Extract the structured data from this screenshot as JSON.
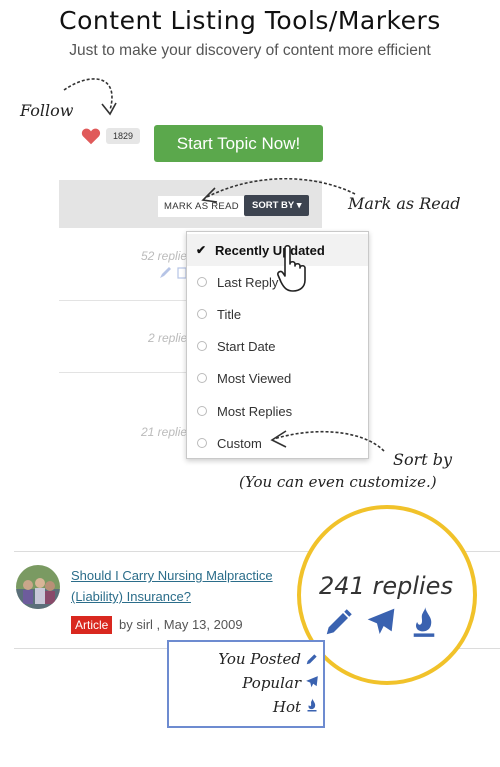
{
  "header": {
    "title": "Content Listing Tools/Markers",
    "subtitle": "Just to make your discovery of content more efficient"
  },
  "follow": {
    "label": "Follow",
    "count": "1829"
  },
  "start_topic": {
    "label": "Start Topic Now!"
  },
  "toolbar": {
    "mark_as_read": "MARK AS READ",
    "sort_by": "SORT BY ▾",
    "mark_annotation": "Mark as Read"
  },
  "ghost_rows": [
    {
      "text": "52 replie"
    },
    {
      "text": "2 replie"
    },
    {
      "text": "21 replie"
    }
  ],
  "sort_menu": {
    "items": [
      {
        "label": "Recently Updated",
        "selected": true
      },
      {
        "label": "Last Reply",
        "selected": false
      },
      {
        "label": "Title",
        "selected": false
      },
      {
        "label": "Start Date",
        "selected": false
      },
      {
        "label": "Most Viewed",
        "selected": false
      },
      {
        "label": "Most Replies",
        "selected": false
      },
      {
        "label": "Custom",
        "selected": false
      }
    ],
    "annotation": "Sort by",
    "annotation_note": "(You can even customize.)"
  },
  "topic": {
    "title_line1": "Should I Carry Nursing Malpractice",
    "title_line2": "(Liability) Insurance?",
    "tag": "Article",
    "byline": "by sirl , May 13, 2009"
  },
  "callout": {
    "replies": "241 replies",
    "icons": [
      "pencil-icon",
      "paper-plane-icon",
      "flame-icon"
    ],
    "accent": "#f1c22a"
  },
  "legend": {
    "items": [
      {
        "label": "You Posted",
        "icon": "pencil-icon"
      },
      {
        "label": "Popular",
        "icon": "paper-plane-icon"
      },
      {
        "label": "Hot",
        "icon": "flame-icon"
      }
    ],
    "border_color": "#6d8bd0"
  },
  "colors": {
    "start_button": "#5ba84c",
    "sort_button": "#3d4450",
    "article_tag": "#d9281f",
    "heart": "#e05a5a",
    "link": "#2b6d8a",
    "icon_blue": "#3a62b0"
  }
}
